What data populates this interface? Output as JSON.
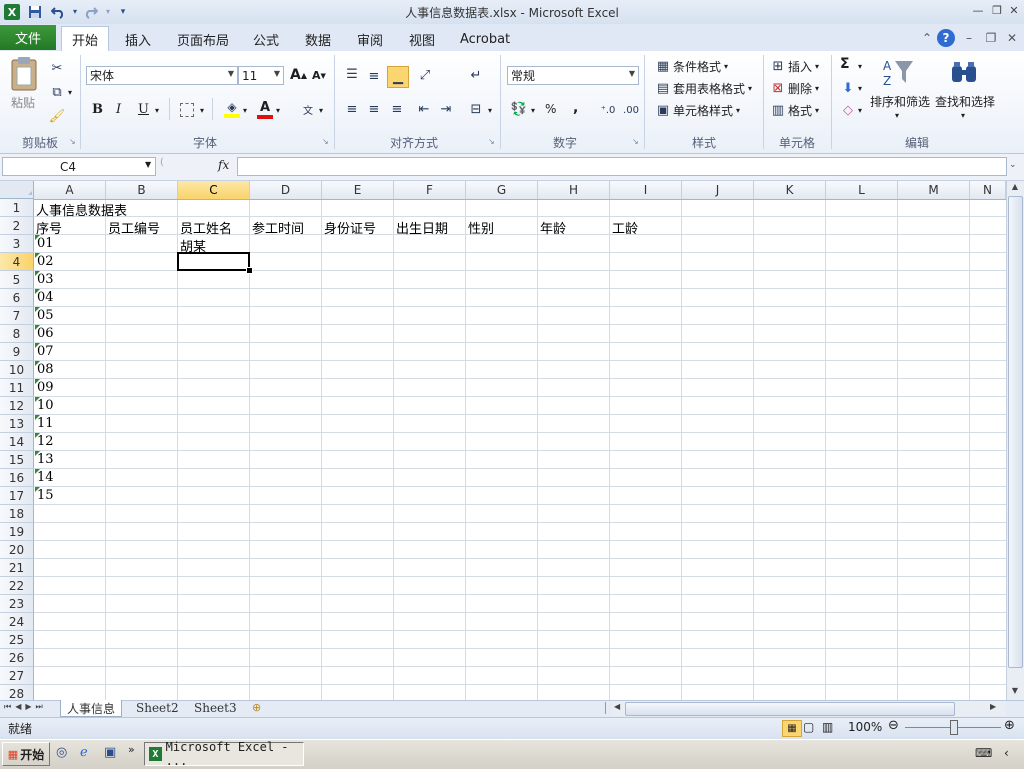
{
  "window": {
    "title": "人事信息数据表.xlsx  -  Microsoft Excel"
  },
  "quick_access": {
    "save_icon": "save-icon",
    "undo_icon": "undo-icon",
    "redo_icon": "redo-icon"
  },
  "ribbon_tabs": {
    "file": "文件",
    "items": [
      "开始",
      "插入",
      "页面布局",
      "公式",
      "数据",
      "审阅",
      "视图",
      "Acrobat"
    ],
    "active": "开始"
  },
  "clipboard": {
    "paste": "粘贴",
    "group": "剪贴板"
  },
  "font": {
    "name": "宋体",
    "size": "11",
    "bold": "B",
    "italic": "I",
    "underline": "U",
    "group": "字体",
    "grow": "A",
    "shrink": "A",
    "color_letter": "A"
  },
  "alignment": {
    "group": "对齐方式"
  },
  "number": {
    "format": "常规",
    "percent": "%",
    "comma": ",",
    "group": "数字"
  },
  "styles": {
    "conditional": "条件格式",
    "table": "套用表格格式",
    "cell": "单元格样式",
    "group": "样式"
  },
  "cells": {
    "insert": "插入",
    "delete": "删除",
    "format": "格式",
    "group": "单元格"
  },
  "editing": {
    "sum": "Σ",
    "sort_filter": "排序和筛选",
    "find_select": "查找和选择",
    "group": "编辑"
  },
  "formula_bar": {
    "name_box": "C4",
    "fx": "fx",
    "value": ""
  },
  "columns": [
    "A",
    "B",
    "C",
    "D",
    "E",
    "F",
    "G",
    "H",
    "I",
    "J",
    "K",
    "L",
    "M",
    "N"
  ],
  "selected": {
    "col": "C",
    "row": 4
  },
  "rows": [
    1,
    2,
    3,
    4,
    5,
    6,
    7,
    8,
    9,
    10,
    11,
    12,
    13,
    14,
    15,
    16,
    17,
    18,
    19,
    20,
    21,
    22,
    23,
    24,
    25,
    26,
    27,
    28
  ],
  "sheet": {
    "title": "人事信息数据表",
    "headers": [
      "序号",
      "员工编号",
      "员工姓名",
      "参工时间",
      "身份证号",
      "出生日期",
      "性别",
      "年龄",
      "工龄"
    ],
    "c3": "胡某",
    "serials": [
      "01",
      "02",
      "03",
      "04",
      "05",
      "06",
      "07",
      "08",
      "09",
      "10",
      "11",
      "12",
      "13",
      "14",
      "15"
    ]
  },
  "sheet_tabs": [
    "人事信息",
    "Sheet2",
    "Sheet3"
  ],
  "active_sheet": "人事信息",
  "status": {
    "ready": "就绪",
    "zoom": "100%"
  },
  "taskbar": {
    "start": "开始",
    "window": "Microsoft Excel - ..."
  }
}
